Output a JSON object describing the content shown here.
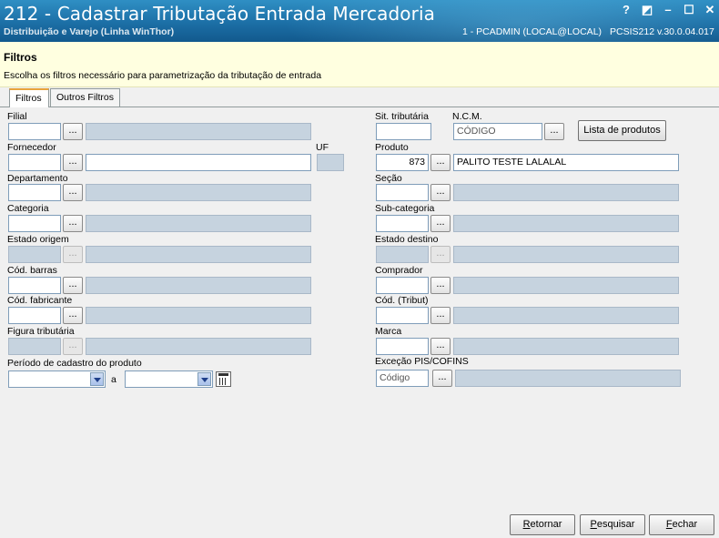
{
  "window": {
    "title": "212 - Cadastrar Tributação Entrada Mercadoria",
    "subtitle": "Distribuição e Varejo (Linha WinThor)",
    "session": "1 - PCADMIN (LOCAL@LOCAL)",
    "version": "PCSIS212  v.30.0.04.017",
    "controls": {
      "help": "?",
      "restore": "◩",
      "minimize": "–",
      "maximize": "☐",
      "close": "✕"
    }
  },
  "header": {
    "title": "Filtros",
    "description": "Escolha os filtros necessário para parametrização da tributação de entrada"
  },
  "tabs": [
    "Filtros",
    "Outros Filtros"
  ],
  "form": {
    "browse_label": "...",
    "filial": {
      "label": "Filial",
      "code": "",
      "desc": ""
    },
    "fornecedor": {
      "label": "Fornecedor",
      "code": "",
      "desc": ""
    },
    "uf": {
      "label": "UF",
      "value": ""
    },
    "departamento": {
      "label": "Departamento",
      "code": "",
      "desc": ""
    },
    "categoria": {
      "label": "Categoria",
      "code": "",
      "desc": ""
    },
    "estado_origem": {
      "label": "Estado origem",
      "code": "",
      "desc": ""
    },
    "cod_barras": {
      "label": "Cód. barras",
      "code": "",
      "desc": ""
    },
    "cod_fabricante": {
      "label": "Cód. fabricante",
      "code": "",
      "desc": ""
    },
    "figura_tributaria": {
      "label": "Figura tributária",
      "code": "",
      "desc": ""
    },
    "periodo": {
      "label": "Período de cadastro do produto",
      "from": "",
      "separator": "a",
      "to": ""
    },
    "sit_tributaria": {
      "label": "Sit. tributária",
      "value": ""
    },
    "ncm": {
      "label": "N.C.M.",
      "value": "CÓDIGO"
    },
    "lista_produtos": "Lista de produtos",
    "produto": {
      "label": "Produto",
      "code": "873",
      "desc": "PALITO TESTE LALALAL"
    },
    "secao": {
      "label": "Seção",
      "code": "",
      "desc": ""
    },
    "sub_categoria": {
      "label": "Sub-categoria",
      "code": "",
      "desc": ""
    },
    "estado_destino": {
      "label": "Estado destino",
      "code": "",
      "desc": ""
    },
    "comprador": {
      "label": "Comprador",
      "code": "",
      "desc": ""
    },
    "cod_tribut": {
      "label": "Cód. (Tribut)",
      "code": "",
      "desc": ""
    },
    "marca": {
      "label": "Marca",
      "code": "",
      "desc": ""
    },
    "excecao_pis": {
      "label": "Exceção PIS/COFINS",
      "code": "Código",
      "desc": ""
    }
  },
  "footer": {
    "retornar": {
      "key": "R",
      "rest": "etornar"
    },
    "pesquisar": {
      "key": "P",
      "rest": "esquisar"
    },
    "fechar": {
      "key": "F",
      "rest": "echar"
    }
  }
}
